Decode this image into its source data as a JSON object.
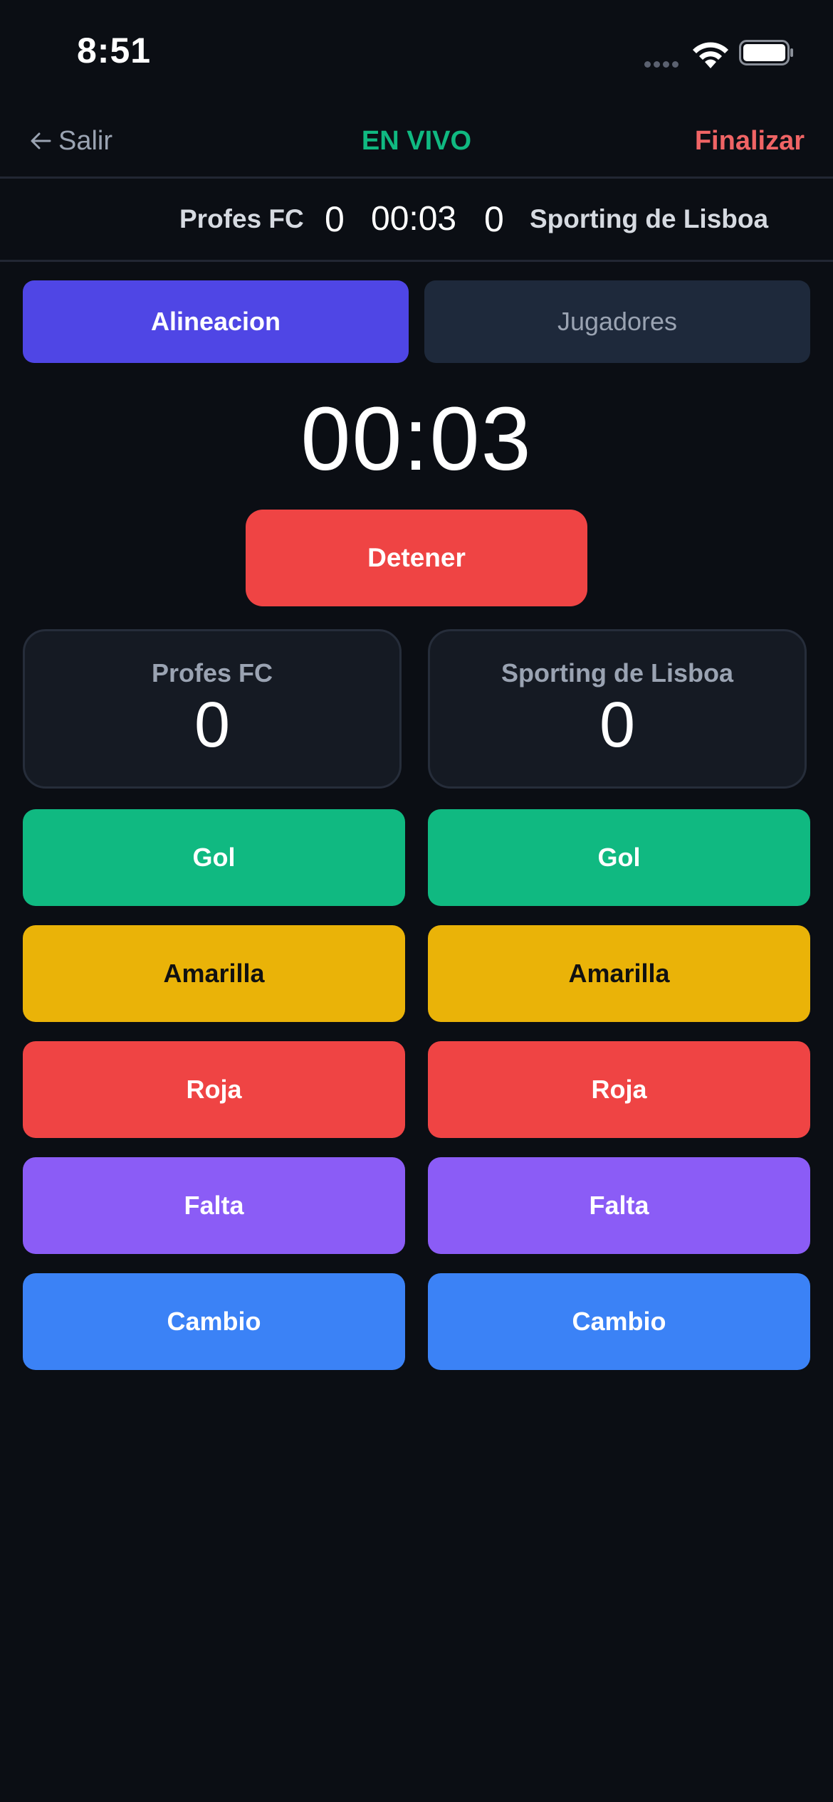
{
  "status_bar": {
    "time": "8:51"
  },
  "header": {
    "back_label": "Salir",
    "live_label": "EN VIVO",
    "finish_label": "Finalizar"
  },
  "scoreboard": {
    "home_name": "Profes FC",
    "home_score": "0",
    "clock": "00:03",
    "away_score": "0",
    "away_name": "Sporting de Lisboa"
  },
  "tabs": [
    {
      "label": "Alineacion",
      "active": true
    },
    {
      "label": "Jugadores",
      "active": false
    }
  ],
  "timer": {
    "value": "00:03",
    "stop_label": "Detener"
  },
  "teams": {
    "home": {
      "name": "Profes FC",
      "score": "0"
    },
    "away": {
      "name": "Sporting de Lisboa",
      "score": "0"
    }
  },
  "actions": {
    "goal": "Gol",
    "yellow": "Amarilla",
    "red": "Roja",
    "foul": "Falta",
    "sub": "Cambio"
  },
  "colors": {
    "background": "#0b0e14",
    "live": "#10b981",
    "finish": "#f06465",
    "tab_active": "#4f46e5",
    "tab_inactive": "#1e293b",
    "stop": "#ef4444",
    "goal": "#10b981",
    "yellow": "#eab308",
    "red": "#ef4444",
    "foul": "#8b5cf6",
    "sub": "#3b82f6"
  }
}
